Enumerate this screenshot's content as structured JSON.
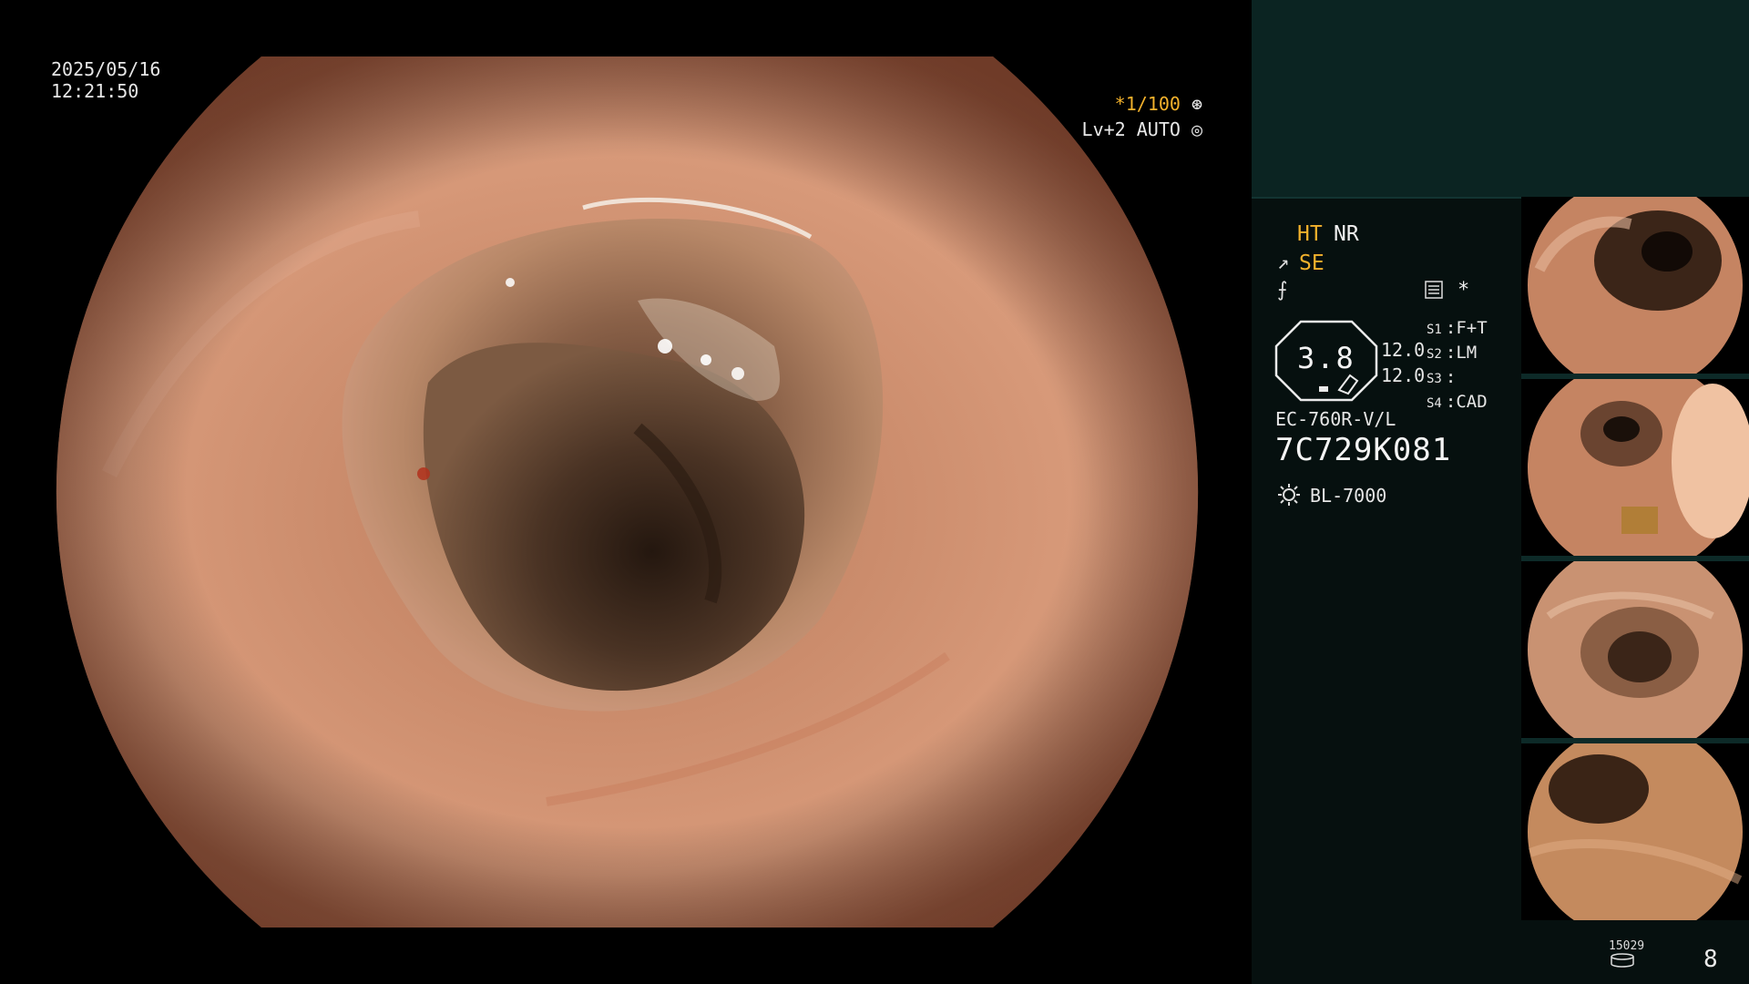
{
  "overlay": {
    "date": "2025/05/16",
    "time": "12:21:50",
    "shutter_speed": "*1/100",
    "iris_mode": "Lv+2 AUTO"
  },
  "panel": {
    "mode_ht": "HT",
    "mode_nr": "NR",
    "mode_se": "SE",
    "star": "*",
    "gauge_value": "3.8",
    "gauge_nums": [
      "12.0",
      "12.0"
    ],
    "switches": [
      {
        "label": "S1",
        "value": "F+T"
      },
      {
        "label": "S2",
        "value": "LM"
      },
      {
        "label": "S3",
        "value": ""
      },
      {
        "label": "S4",
        "value": "CAD"
      }
    ],
    "scope_model": "EC-760R-V/L",
    "scope_serial": "7C729K081",
    "light_source": "BL-7000",
    "count_icon_text": "15029",
    "image_count": "8"
  },
  "colors": {
    "accent_yellow": "#f2b12c",
    "panel_bg": "#06100f",
    "panel_top_bg": "#0b2422",
    "mucosa": "#cf8a6a"
  },
  "icons": [
    "shutter-icon",
    "iris-icon",
    "structure-enhance-icon",
    "edge-enhance-icon",
    "printer-status-icon",
    "light-source-icon",
    "storage-icon"
  ]
}
